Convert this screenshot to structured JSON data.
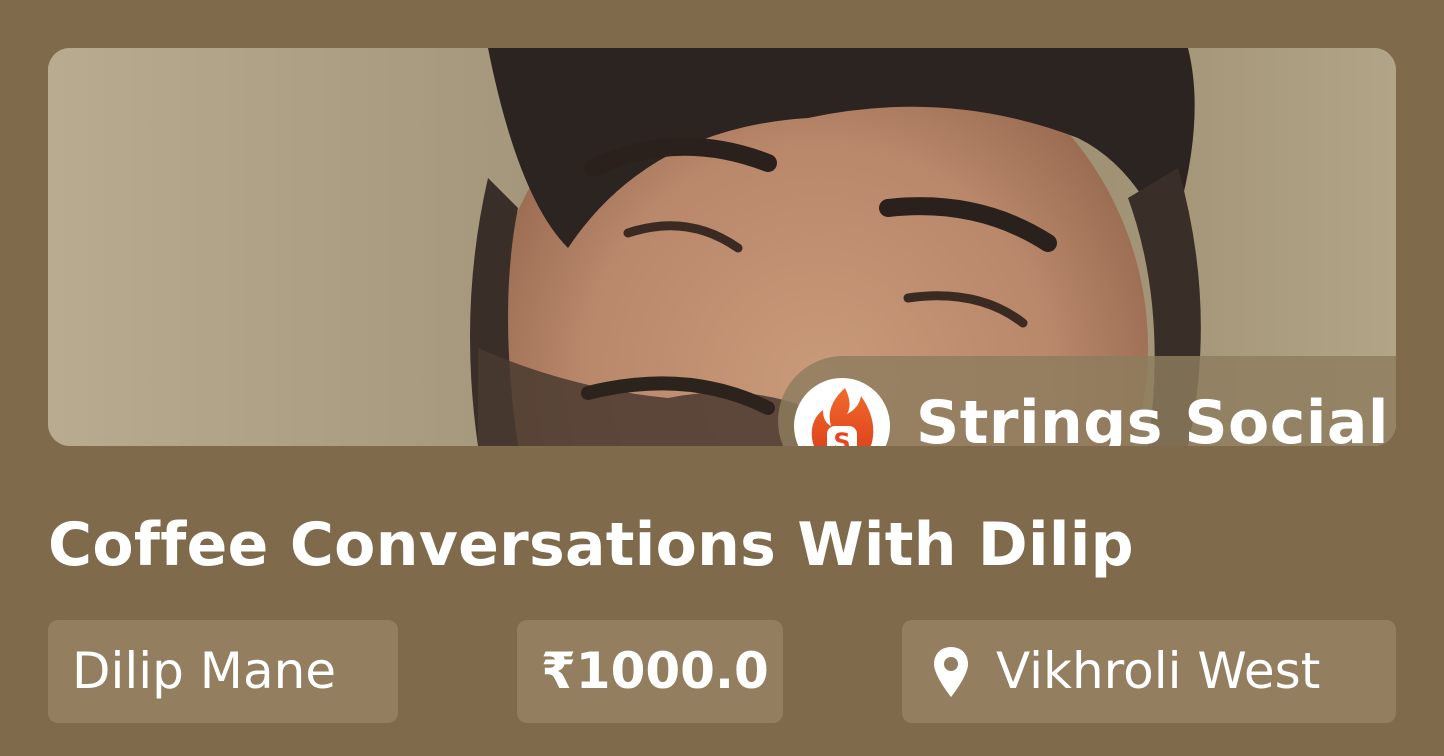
{
  "brand": {
    "name": "Strings Social",
    "logo_letter": "S",
    "logo_icon": "flame-icon",
    "accent_color": "#e8451e"
  },
  "event": {
    "title": "Coffee Conversations With Dilip",
    "host": "Dilip Mane",
    "price": "₹1000.0",
    "location": "Vikhroli West",
    "location_icon": "map-pin-icon"
  },
  "colors": {
    "background": "#7f6a4b",
    "chip": "#937f5f",
    "text": "#ffffff"
  }
}
